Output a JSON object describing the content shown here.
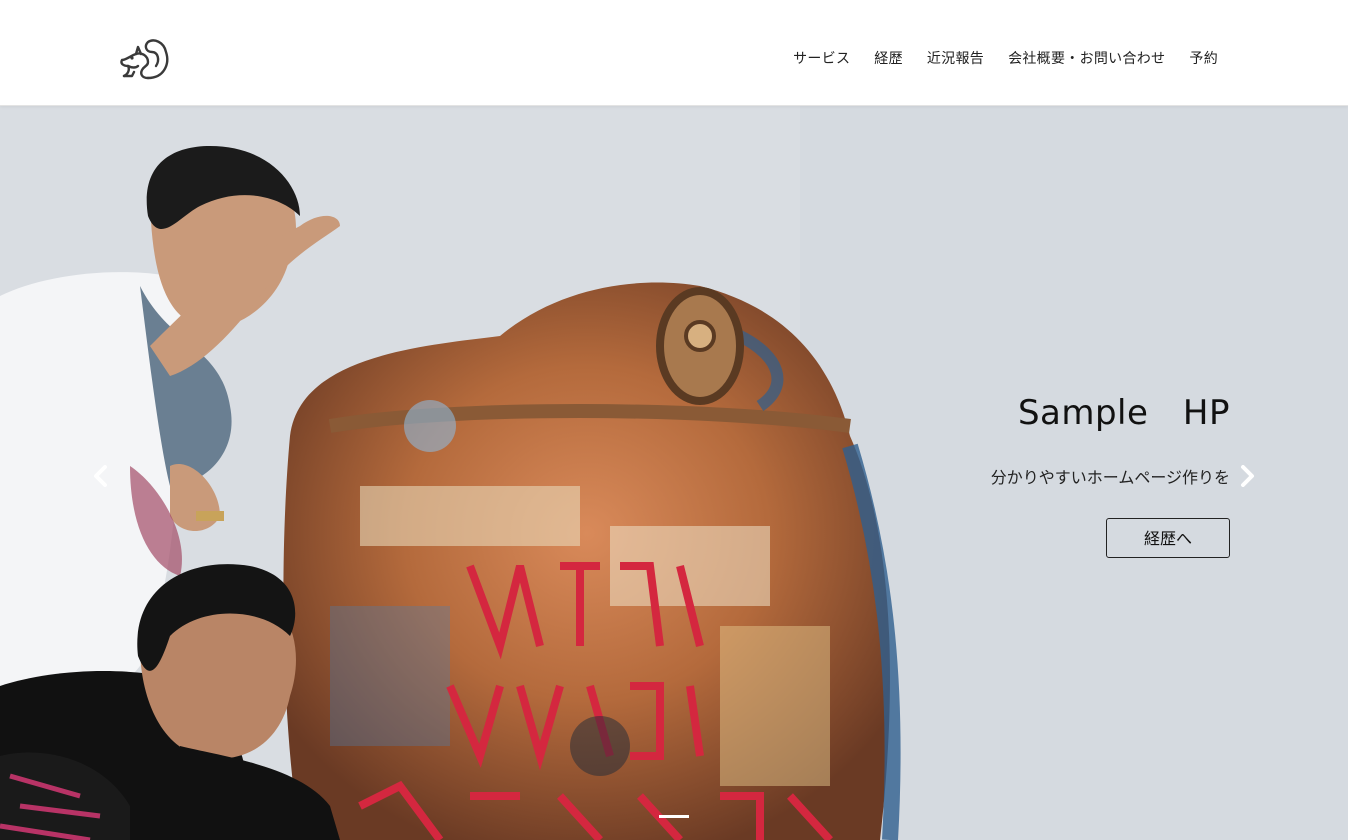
{
  "brand": {
    "logo_icon": "squirrel-icon"
  },
  "nav": {
    "items": [
      {
        "label": "サービス"
      },
      {
        "label": "経歴"
      },
      {
        "label": "近況報告"
      },
      {
        "label": "会社概要・お問い合わせ"
      },
      {
        "label": "予約"
      }
    ]
  },
  "carousel": {
    "title": "Sample　HP",
    "subtitle": "分かりやすいホームページ作りを",
    "button_label": "経歴へ",
    "prev_icon": "chevron-left-icon",
    "next_icon": "chevron-right-icon",
    "slide_count": 1,
    "active_slide": 1
  }
}
